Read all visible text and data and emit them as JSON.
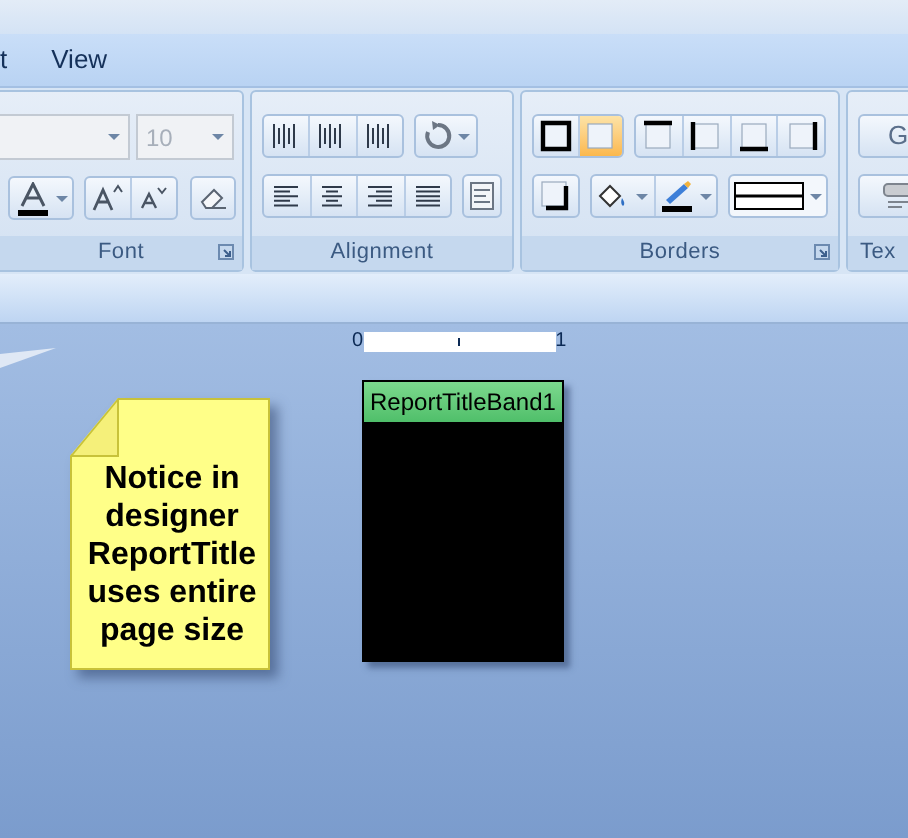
{
  "menu": [
    {
      "label": "t"
    },
    {
      "label": "View"
    }
  ],
  "ribbon": {
    "font": {
      "label": "Font",
      "font_name": {
        "disabled": true
      },
      "font_size": {
        "value": "10",
        "disabled": true
      }
    },
    "alignment": {
      "label": "Alignment"
    },
    "borders": {
      "label": "Borders",
      "border_buttons": [
        {
          "kind": "all",
          "selected": false
        },
        {
          "kind": "none",
          "selected": true
        },
        {
          "kind": "top",
          "selected": false
        },
        {
          "kind": "left",
          "selected": false
        },
        {
          "kind": "bottom",
          "selected": false
        },
        {
          "kind": "right",
          "selected": false
        }
      ]
    },
    "text": {
      "label": "Tex",
      "button_label": "G"
    }
  },
  "ruler": {
    "start": "0",
    "end": "1"
  },
  "note": {
    "text": "Notice in designer ReportTitle uses entire page size"
  },
  "band": {
    "title": "ReportTitleBand1"
  }
}
